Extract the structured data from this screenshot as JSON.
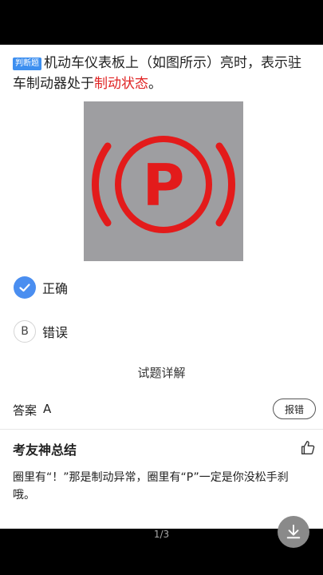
{
  "question": {
    "tag": "判断题",
    "text_before": "机动车仪表板上（如图所示）亮时，表示驻车制动器处于",
    "highlight": "制动状态",
    "text_after": "。"
  },
  "figure": {
    "icon": "parking-brake-warning-icon",
    "letter": "P",
    "icon_color": "#e31b1b",
    "background_color": "#9e9ea1"
  },
  "options": [
    {
      "mark": "check-icon",
      "label": "正确",
      "selected": true
    },
    {
      "mark": "B",
      "label": "错误",
      "selected": false
    }
  ],
  "details": {
    "title": "试题详解",
    "answer_label": "答案",
    "answer_value": "A",
    "report_label": "报错"
  },
  "summary": {
    "title": "考友神总结",
    "text": "圈里有“！”那是制动异常，圈里有“P”一定是你没松手刹哦。",
    "like_icon": "thumbs-up-icon"
  },
  "footer": {
    "page_indicator": "1/3",
    "download_icon": "download-icon"
  },
  "colors": {
    "accent": "#4a8ef0",
    "highlight": "#e02323"
  }
}
